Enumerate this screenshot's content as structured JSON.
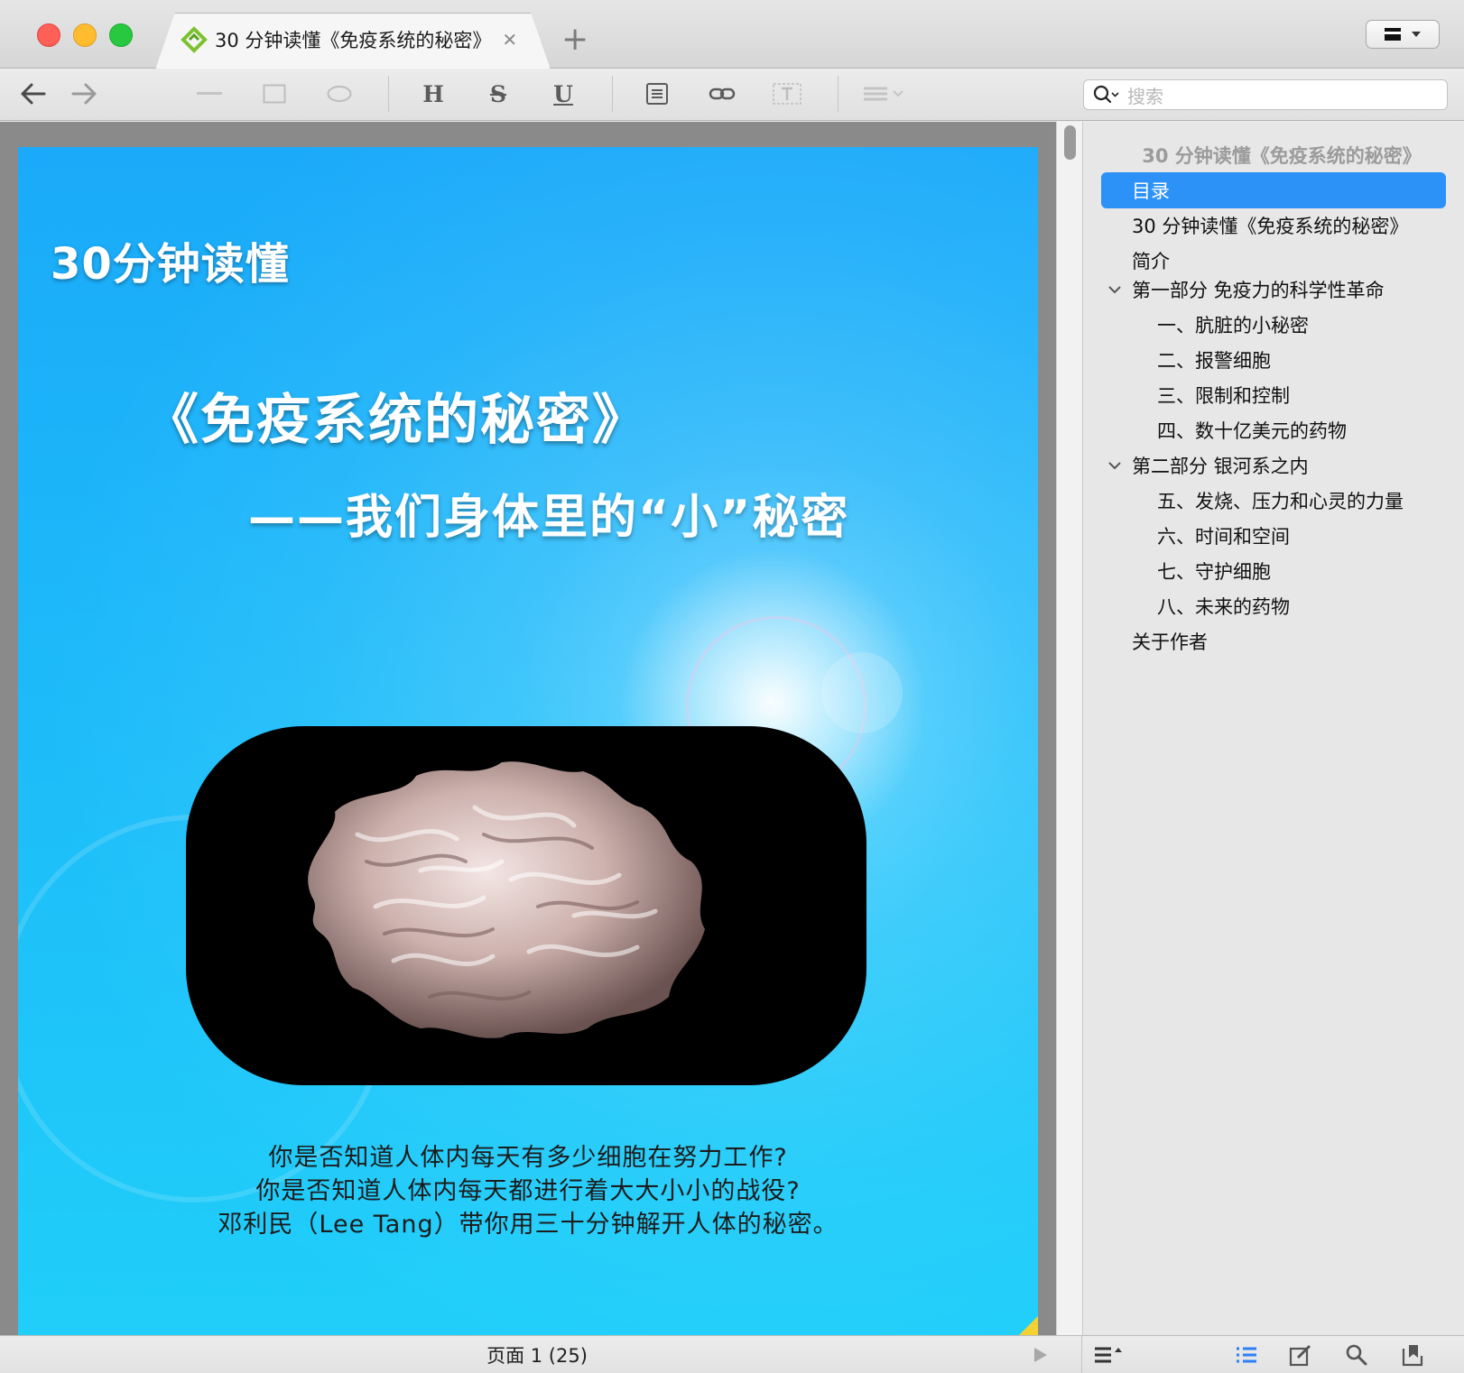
{
  "tab": {
    "title": "30 分钟读懂《免疫系统的秘密》"
  },
  "search": {
    "placeholder": "搜索"
  },
  "toolbar": {
    "bold_label": "H",
    "strike_label": "S",
    "underline_label": "U"
  },
  "page": {
    "kicker": "30分钟读懂",
    "title": "《免疫系统的秘密》",
    "subtitle": "——我们身体里的“小”秘密",
    "description": [
      "你是否知道人体内每天有多少细胞在努力工作?",
      "你是否知道人体内每天都进行着大大小小的战役?",
      "邓利民（Lee Tang）带你用三十分钟解开人体的秘密。"
    ]
  },
  "outline": {
    "header": "30 分钟读懂《免疫系统的秘密》",
    "items": [
      {
        "label": "目录",
        "level": 0,
        "selected": true
      },
      {
        "label": "30 分钟读懂《免疫系统的秘密》",
        "level": 0
      },
      {
        "label": "简介",
        "level": 0
      },
      {
        "label": "第一部分 免疫力的科学性革命",
        "level": 0,
        "expanded": true
      },
      {
        "label": "一、肮脏的小秘密",
        "level": 1
      },
      {
        "label": "二、报警细胞",
        "level": 1
      },
      {
        "label": "三、限制和控制",
        "level": 1
      },
      {
        "label": "四、数十亿美元的药物",
        "level": 1
      },
      {
        "label": "第二部分 银河系之内",
        "level": 0,
        "expanded": true
      },
      {
        "label": "五、发烧、压力和心灵的力量",
        "level": 1
      },
      {
        "label": "六、时间和空间",
        "level": 1
      },
      {
        "label": "七、守护细胞",
        "level": 1
      },
      {
        "label": "八、未来的药物",
        "level": 1
      },
      {
        "label": "关于作者",
        "level": 0
      }
    ]
  },
  "status": {
    "page_label": "页面 1 (25)"
  },
  "colors": {
    "selection": "#2d92f7",
    "page_blue": "#22b4f8",
    "tab_icon_green": "#7cc22e"
  }
}
